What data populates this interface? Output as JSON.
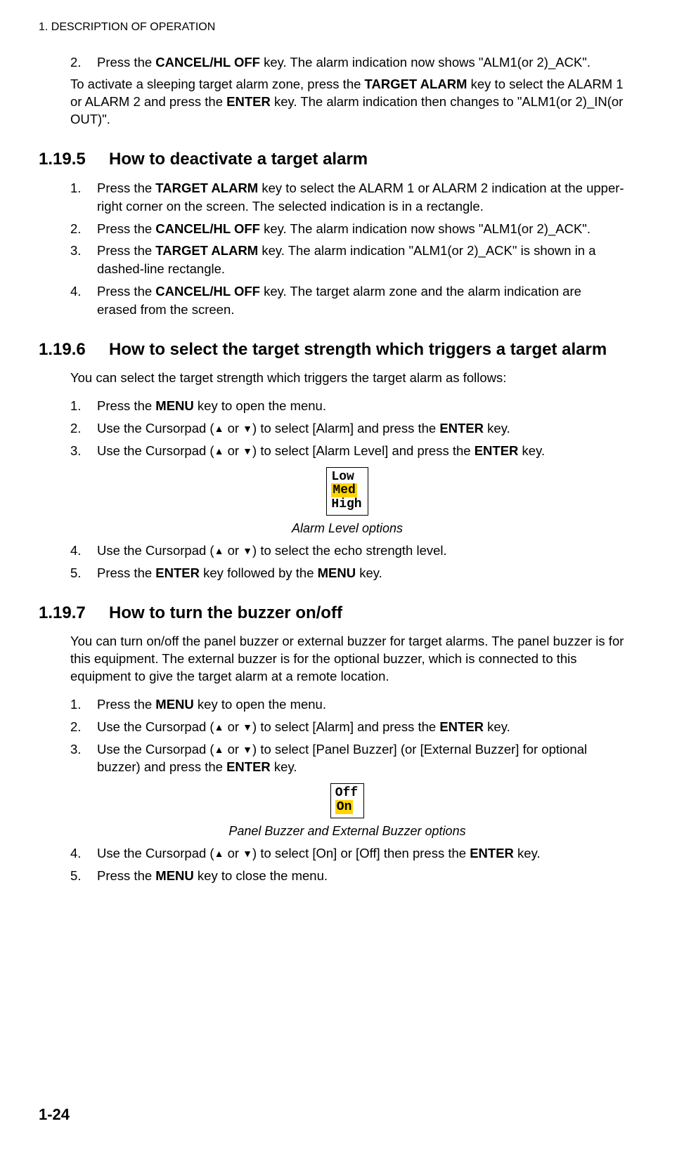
{
  "chapterHeader": "1.  DESCRIPTION OF OPERATION",
  "introItem": {
    "num": "2.",
    "pre": "Press the ",
    "key": "CANCEL/HL OFF",
    "post": " key. The alarm indication now shows \"ALM1(or 2)_ACK\"."
  },
  "introPara": {
    "t1": "To activate a sleeping target alarm zone, press the ",
    "k1": "TARGET ALARM",
    "t2": " key to select the ALARM 1 or ALARM 2 and press the ",
    "k2": "ENTER",
    "t3": " key. The alarm indication then changes to \"ALM1(or 2)_IN(or OUT)\"."
  },
  "s1195": {
    "num": "1.19.5",
    "title": "How to deactivate a target alarm",
    "items": [
      {
        "num": "1.",
        "t1": "Press the ",
        "k1": "TARGET ALARM",
        "t2": " key to select the ALARM 1 or ALARM 2 indication at the upper-right corner on the screen. The selected indication is in a rectangle."
      },
      {
        "num": "2.",
        "t1": "Press the ",
        "k1": "CANCEL/HL OFF",
        "t2": " key. The alarm indication now shows \"ALM1(or 2)_ACK\"."
      },
      {
        "num": "3.",
        "t1": "Press the ",
        "k1": "TARGET ALARM",
        "t2": " key. The alarm indication \"ALM1(or 2)_ACK\" is shown in a dashed-line rectangle."
      },
      {
        "num": "4.",
        "t1": "Press the ",
        "k1": "CANCEL/HL OFF",
        "t2": " key. The target alarm zone and the alarm indication are erased from the screen."
      }
    ]
  },
  "s1196": {
    "num": "1.19.6",
    "title": "How to select the target strength which triggers a target alarm",
    "intro": "You can select the target strength which triggers the target alarm as follows:",
    "item1": {
      "num": "1.",
      "t1": "Press the ",
      "k1": "MENU",
      "t2": " key to open the menu."
    },
    "item2": {
      "num": "2.",
      "t1": "Use the Cursorpad (",
      "t2": " or ",
      "t3": ") to select [Alarm] and press the ",
      "k1": "ENTER",
      "t4": " key."
    },
    "item3": {
      "num": "3.",
      "t1": "Use the Cursorpad (",
      "t2": " or ",
      "t3": ") to select [Alarm Level] and press the ",
      "k1": "ENTER",
      "t4": " key."
    },
    "opts": {
      "a": "Low",
      "b": "Med",
      "c": "High"
    },
    "caption": "Alarm Level options",
    "item4": {
      "num": "4.",
      "t1": "Use the Cursorpad (",
      "t2": " or ",
      "t3": ") to select the echo strength level."
    },
    "item5": {
      "num": "5.",
      "t1": "Press the ",
      "k1": "ENTER",
      "t2": " key followed by the ",
      "k2": "MENU",
      "t3": " key."
    }
  },
  "s1197": {
    "num": "1.19.7",
    "title": "How to turn the buzzer on/off",
    "intro": "You can turn on/off the panel buzzer or external buzzer for target alarms. The panel buzzer is for this equipment. The external buzzer is for the optional buzzer, which is connected to this equipment to give the target alarm at a remote location.",
    "item1": {
      "num": "1.",
      "t1": "Press the ",
      "k1": "MENU",
      "t2": " key to open the menu."
    },
    "item2": {
      "num": "2.",
      "t1": "Use the Cursorpad (",
      "t2": " or ",
      "t3": ") to select [Alarm] and press the ",
      "k1": "ENTER",
      "t4": " key."
    },
    "item3": {
      "num": "3.",
      "t1": "Use the Cursorpad (",
      "t2": " or ",
      "t3": ") to select [Panel Buzzer] (or [External Buzzer] for optional buzzer) and press the ",
      "k1": "ENTER",
      "t4": " key."
    },
    "opts": {
      "a": "Off",
      "b": "On"
    },
    "caption": "Panel Buzzer and External Buzzer options",
    "item4": {
      "num": "4.",
      "t1": "Use the Cursorpad (",
      "t2": " or ",
      "t3": ") to select [On] or [Off] then press the ",
      "k1": "ENTER",
      "t4": " key."
    },
    "item5": {
      "num": "5.",
      "t1": "Press the ",
      "k1": "MENU",
      "t2": " key to close the menu."
    }
  },
  "pageNumber": "1-24",
  "arrowUp": "▲",
  "arrowDown": "▼"
}
